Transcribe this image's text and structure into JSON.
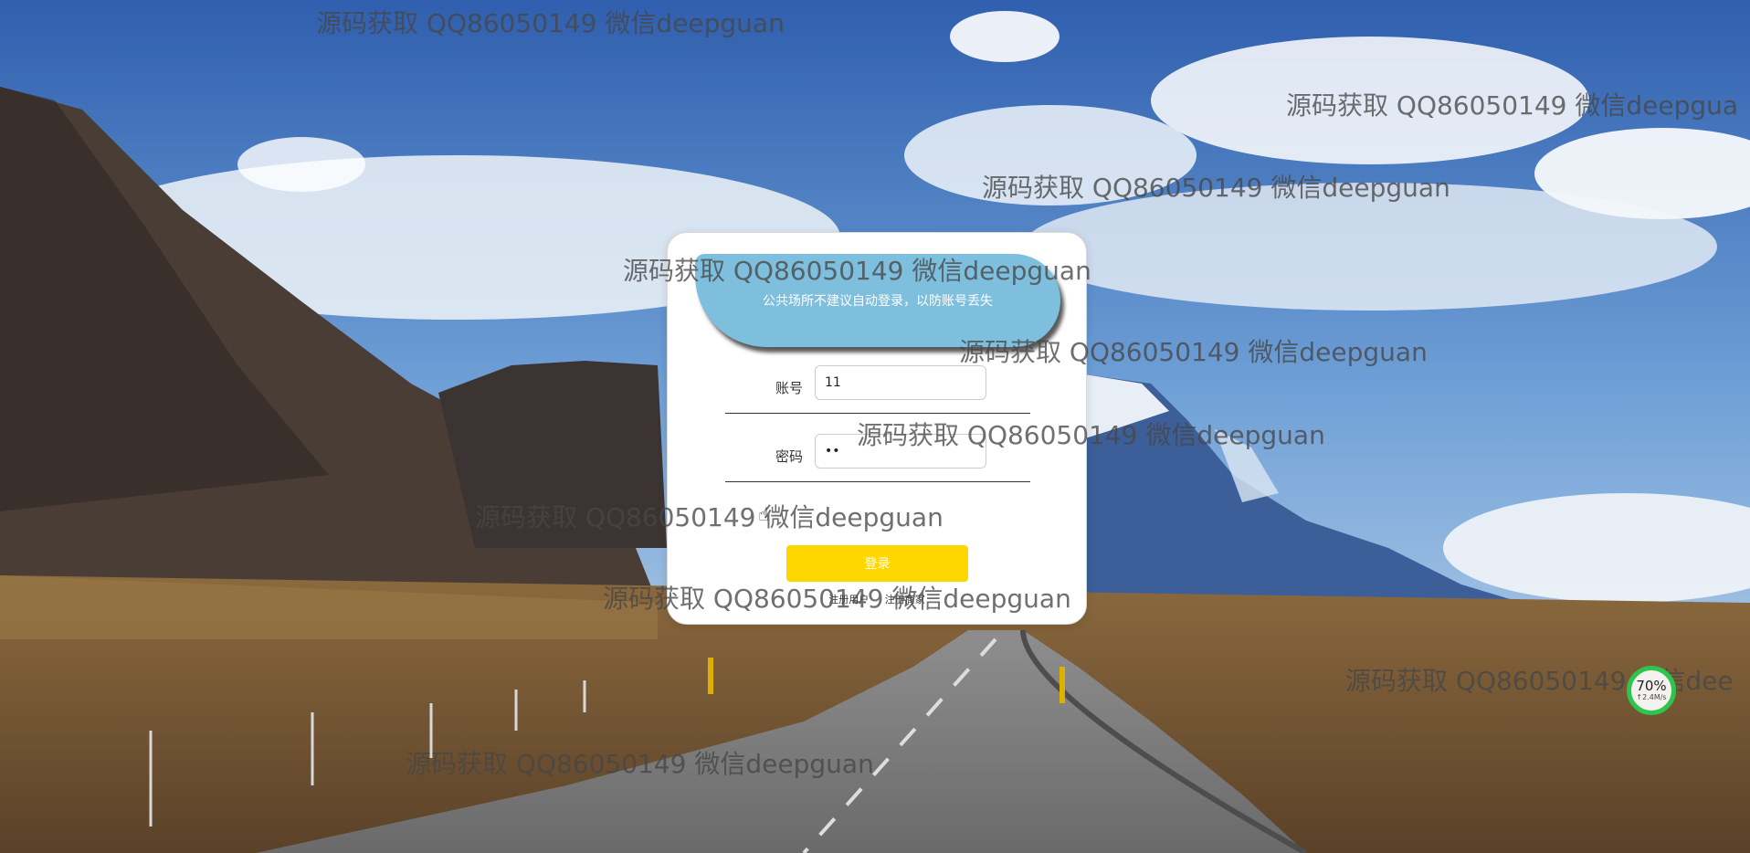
{
  "login": {
    "notice": "公共场所不建议自动登录，以防账号丢失",
    "account_label": "账号",
    "account_value": "11",
    "password_label": "密码",
    "password_value": "••",
    "login_button": "登录",
    "register_user_link": "注册用户",
    "register_merchant_link": "注册商家"
  },
  "watermarks": [
    "源码获取 QQ86050149 微信deepguan",
    "源码获取 QQ86050149 微信deepgua",
    "源码获取 QQ86050149 微信deepguan",
    "源码获取 QQ86050149 微信deepguan",
    "源码获取 QQ86050149 微信deepguan",
    "源码获取 QQ86050149 微信deepguan",
    "源码获取 QQ86050149 微信deepguan",
    "源码获取 QQ86050149 微信deepguan",
    "源码获取 QQ86050149 微信dee",
    "源码获取 QQ86050149 微信deepguan"
  ],
  "speed_widget": {
    "percent": "70%",
    "rate": "↑2.4M/s"
  }
}
